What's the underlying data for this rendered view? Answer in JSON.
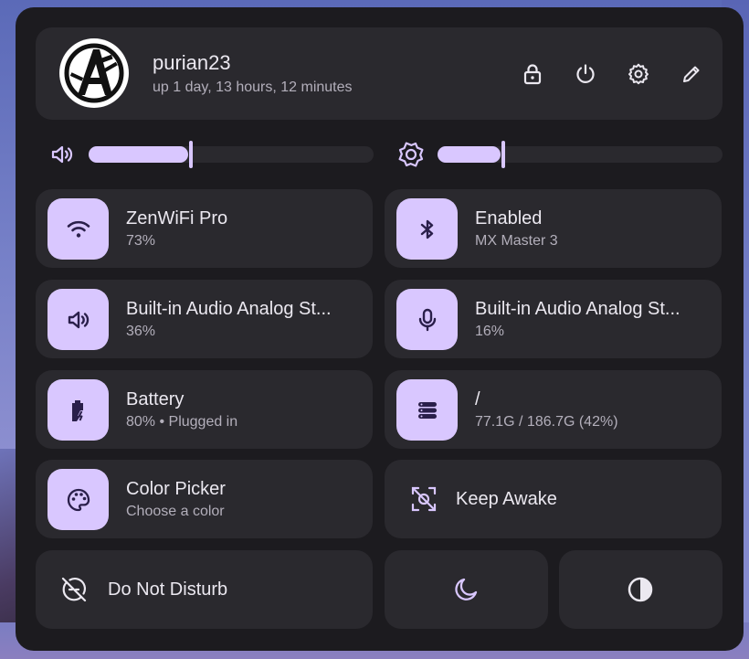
{
  "profile": {
    "username": "purian23",
    "uptime": "up 1 day, 13 hours, 12 minutes"
  },
  "header_actions": [
    {
      "icon": "lock-icon"
    },
    {
      "icon": "power-icon"
    },
    {
      "icon": "gear-icon"
    },
    {
      "icon": "pencil-icon"
    }
  ],
  "sliders": {
    "volume": {
      "icon": "volume-icon",
      "level": 0.35
    },
    "brightness": {
      "icon": "brightness-icon",
      "level": 0.22
    }
  },
  "tiles": {
    "wifi": {
      "title": "ZenWiFi Pro",
      "subtitle": "73%",
      "icon": "wifi-icon"
    },
    "bluetooth": {
      "title": "Enabled",
      "subtitle": "MX Master 3",
      "icon": "bluetooth-icon"
    },
    "audio_output": {
      "title": "Built-in Audio Analog St...",
      "subtitle": "36%",
      "icon": "speaker-icon"
    },
    "audio_input": {
      "title": "Built-in Audio Analog St...",
      "subtitle": "16%",
      "icon": "microphone-icon"
    },
    "battery": {
      "title": "Battery",
      "subtitle": "80% • Plugged in",
      "icon": "battery-charging-icon"
    },
    "disk": {
      "title": "/",
      "subtitle": "77.1G / 186.7G (42%)",
      "icon": "storage-icon"
    },
    "color_picker": {
      "title": "Color Picker",
      "subtitle": "Choose a color",
      "icon": "palette-icon"
    },
    "keep_awake": {
      "label": "Keep Awake",
      "icon": "focus-off-icon"
    },
    "do_not_disturb": {
      "label": "Do Not Disturb",
      "icon": "do-not-disturb-icon"
    },
    "night_mode": {
      "icon": "moon-icon"
    },
    "dark_mode": {
      "icon": "contrast-icon"
    }
  },
  "colors": {
    "accent": "#d9c7ff",
    "panel": "#1c1b1f",
    "card": "#2a292e",
    "text": "#ebe8f0",
    "subtext": "#b3afbb"
  }
}
